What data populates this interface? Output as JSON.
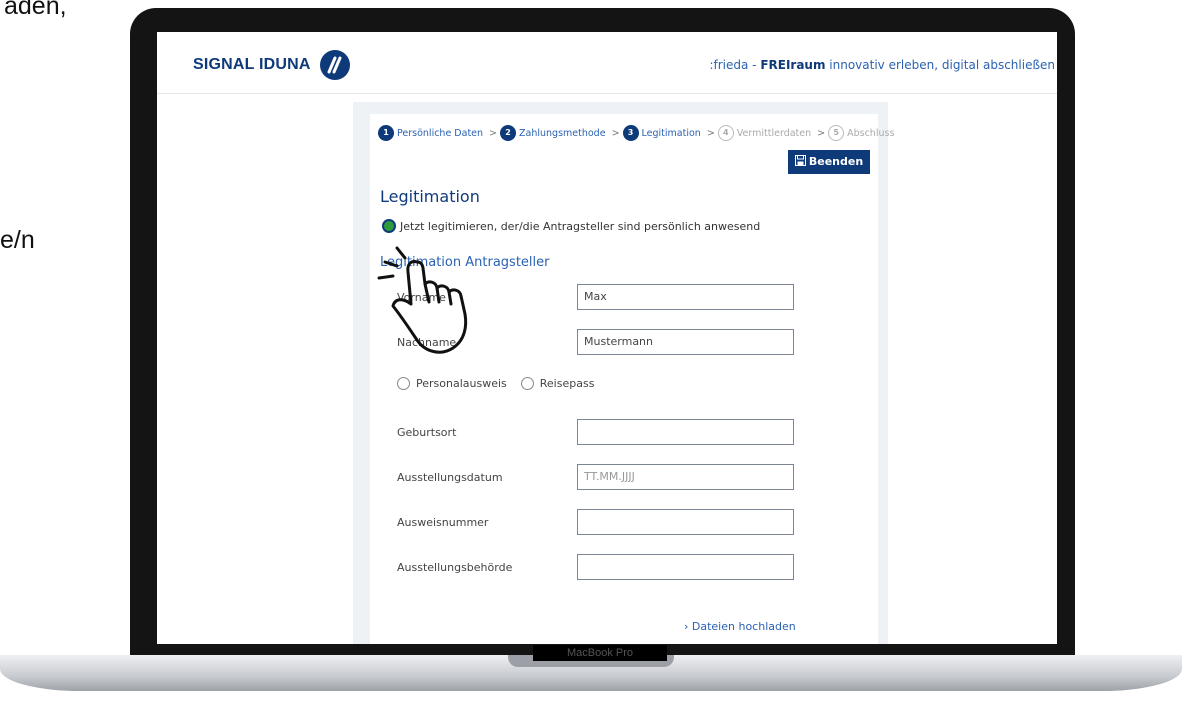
{
  "slide": {
    "top_fragment": "aden,",
    "mid_fragment": "e/n"
  },
  "device": {
    "model_label": "MacBook Pro"
  },
  "header": {
    "logo_text": "SIGNAL IDUNA",
    "logo_mark": "",
    "tagline_prefix": ":frieda - ",
    "tagline_bold": "FREIraum",
    "tagline_suffix": " innovativ erleben, digital abschließen"
  },
  "steps": [
    {
      "num": "1",
      "label": "Persönliche Daten",
      "state": "done"
    },
    {
      "num": "2",
      "label": "Zahlungsmethode",
      "state": "done"
    },
    {
      "num": "3",
      "label": "Legitimation",
      "state": "current"
    },
    {
      "num": "4",
      "label": "Vermittlerdaten",
      "state": "upcoming"
    },
    {
      "num": "5",
      "label": "Abschluss",
      "state": "upcoming"
    }
  ],
  "step_separator": ">",
  "buttons": {
    "beenden_icon": "save-icon",
    "beenden_label": "Beenden"
  },
  "form": {
    "title": "Legitimation",
    "present_option": "Jetzt legitimieren, der/die Antragsteller sind persönlich anwesend",
    "section_title": "Legitimation Antragsteller",
    "fields": {
      "vorname": {
        "label": "Vorname",
        "value": "Max"
      },
      "nachname": {
        "label": "Nachname",
        "value": "Mustermann"
      },
      "geburtsort": {
        "label": "Geburtsort",
        "value": ""
      },
      "ausstellungsdatum": {
        "label": "Ausstellungsdatum",
        "placeholder": "TT.MM.JJJJ"
      },
      "ausweisnummer": {
        "label": "Ausweisnummer",
        "value": ""
      },
      "ausstellungsbehoerde": {
        "label": "Ausstellungsbehörde",
        "value": ""
      }
    },
    "document_types": [
      "Personalausweis",
      "Reisepass"
    ],
    "upload_link": "› Dateien hochladen"
  },
  "colors": {
    "brand_navy": "#0f3a7a",
    "link_blue": "#2b62b3",
    "selected_green": "#2e9b3b",
    "panel_bg": "#eef2f7"
  },
  "overlay": {
    "icon": "pointing-hand-icon"
  }
}
